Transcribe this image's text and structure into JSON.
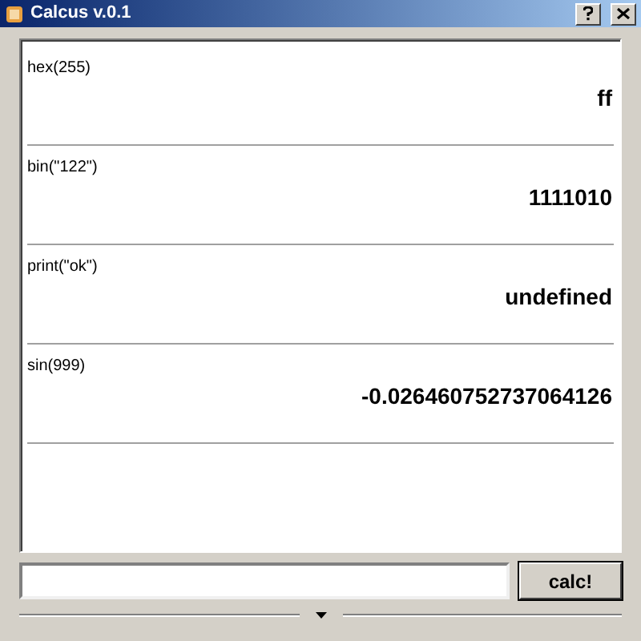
{
  "window": {
    "title": "Calcus v.0.1"
  },
  "entries": [
    {
      "input": "hex(255)",
      "result": "ff"
    },
    {
      "input": "bin(\"122\")",
      "result": "1111010"
    },
    {
      "input": "print(\"ok\")",
      "result": "undefined"
    },
    {
      "input": "sin(999)",
      "result": "-0.026460752737064126"
    }
  ],
  "calc_button": {
    "label": "calc!"
  }
}
